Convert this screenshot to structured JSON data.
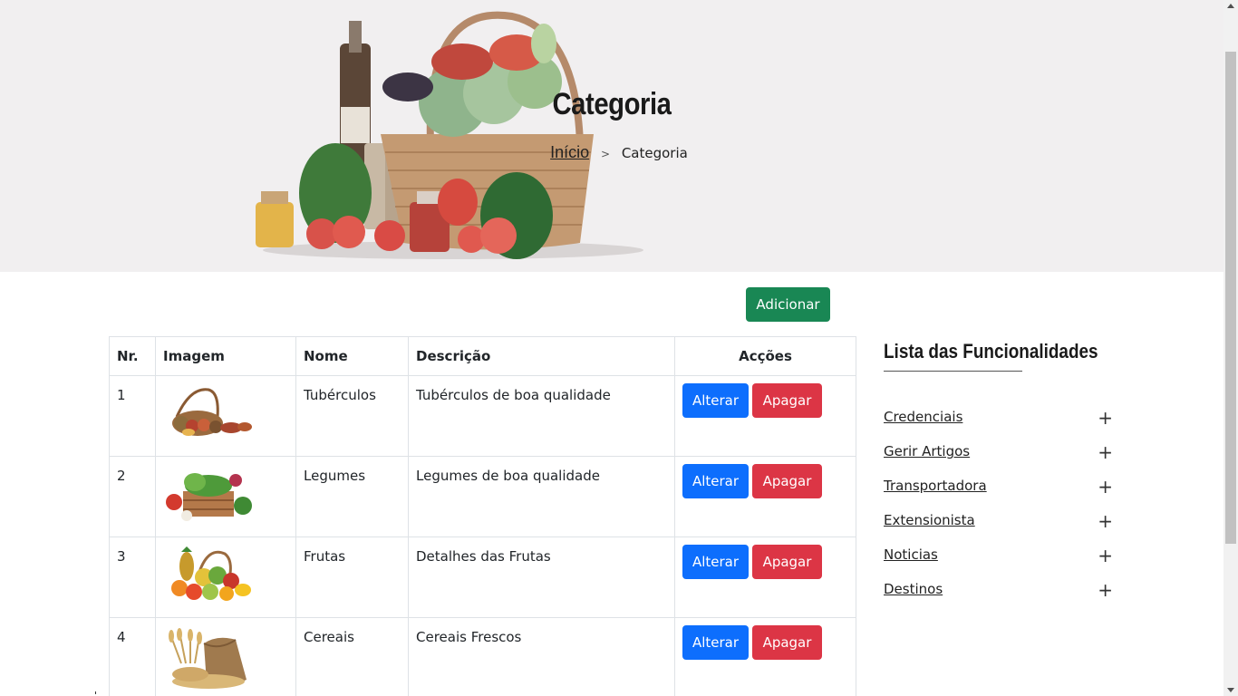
{
  "hero": {
    "title": "Categoria",
    "breadcrumb": {
      "home": "Início",
      "separator": ">",
      "current": "Categoria"
    }
  },
  "actions": {
    "add_label": "Adicionar"
  },
  "table": {
    "headers": {
      "nr": "Nr.",
      "image": "Imagem",
      "name": "Nome",
      "description": "Descrição",
      "actions": "Acções"
    },
    "rows": [
      {
        "nr": "1",
        "image_icon": "basket-of-tubers-image",
        "name": "Tubérculos",
        "description": "Tubérculos de boa qualidade",
        "edit": "Alterar",
        "delete": "Apagar"
      },
      {
        "nr": "2",
        "image_icon": "crate-of-vegetables-image",
        "name": "Legumes",
        "description": "Legumes de boa qualidade",
        "edit": "Alterar",
        "delete": "Apagar"
      },
      {
        "nr": "3",
        "image_icon": "basket-of-fruits-image",
        "name": "Frutas",
        "description": "Detalhes das Frutas",
        "edit": "Alterar",
        "delete": "Apagar"
      },
      {
        "nr": "4",
        "image_icon": "sack-of-grain-image",
        "name": "Cereais",
        "description": "Cereais Frescos",
        "edit": "Alterar",
        "delete": "Apagar"
      }
    ]
  },
  "sidebar": {
    "title": "Lista das Funcionalidades",
    "items": [
      {
        "label": "Credenciais",
        "icon": "plus-icon"
      },
      {
        "label": "Gerir Artigos",
        "icon": "plus-icon"
      },
      {
        "label": "Transportadora",
        "icon": "plus-icon"
      },
      {
        "label": "Extensionista",
        "icon": "plus-icon"
      },
      {
        "label": "Noticias",
        "icon": "plus-icon"
      },
      {
        "label": "Destinos",
        "icon": "plus-icon"
      }
    ]
  },
  "colors": {
    "add": "#198754",
    "edit": "#0d6efd",
    "delete": "#dc3545",
    "hero_bg": "#f1eff0"
  }
}
